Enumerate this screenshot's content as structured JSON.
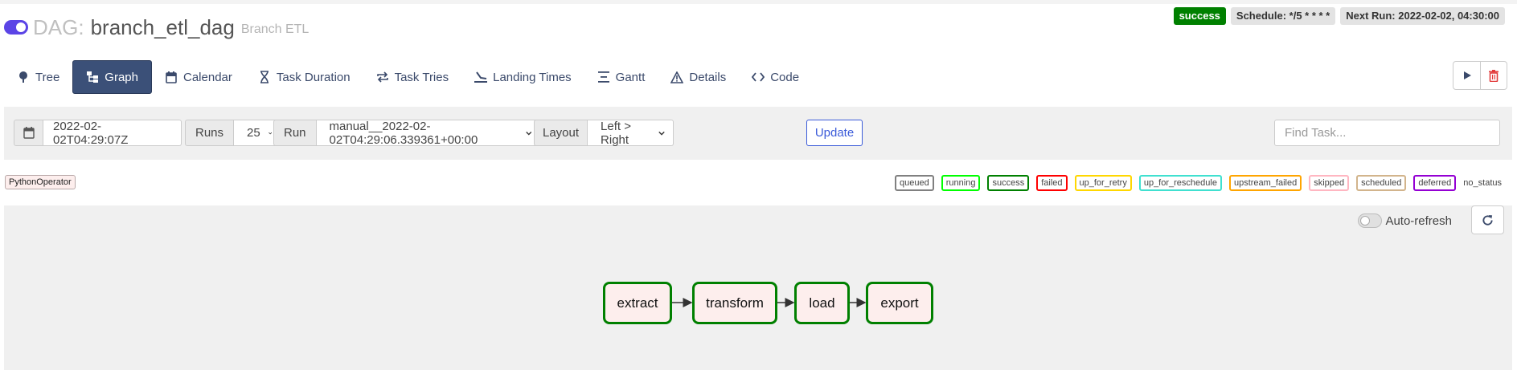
{
  "header": {
    "dag_prefix": "DAG:",
    "dag_id": "branch_etl_dag",
    "description": "Branch ETL",
    "status": "success",
    "schedule": "Schedule: */5 * * * *",
    "next_run": "Next Run: 2022-02-02, 04:30:00"
  },
  "tabs": [
    {
      "label": "Tree",
      "icon": "tree-icon"
    },
    {
      "label": "Graph",
      "icon": "graph-icon",
      "active": true
    },
    {
      "label": "Calendar",
      "icon": "calendar-icon"
    },
    {
      "label": "Task Duration",
      "icon": "hourglass-icon"
    },
    {
      "label": "Task Tries",
      "icon": "retry-icon"
    },
    {
      "label": "Landing Times",
      "icon": "landing-icon"
    },
    {
      "label": "Gantt",
      "icon": "gantt-icon"
    },
    {
      "label": "Details",
      "icon": "warning-triangle-icon"
    },
    {
      "label": "Code",
      "icon": "code-icon"
    }
  ],
  "actions": {
    "trigger": "play-icon",
    "delete": "trash-icon"
  },
  "controls": {
    "base_date": "2022-02-02T04:29:07Z",
    "runs_label": "Runs",
    "runs_value": "25",
    "run_label": "Run",
    "run_value": "manual__2022-02-02T04:29:06.339361+00:00",
    "layout_label": "Layout",
    "layout_value": "Left > Right",
    "update_label": "Update",
    "find_task_placeholder": "Find Task..."
  },
  "legend": {
    "operator": "PythonOperator",
    "operator_color": "#fdeeed",
    "states": [
      {
        "label": "queued",
        "color": "#808080"
      },
      {
        "label": "running",
        "color": "#00ff00"
      },
      {
        "label": "success",
        "color": "#008000"
      },
      {
        "label": "failed",
        "color": "#ff0000"
      },
      {
        "label": "up_for_retry",
        "color": "#ffd700"
      },
      {
        "label": "up_for_reschedule",
        "color": "#40e0d0"
      },
      {
        "label": "upstream_failed",
        "color": "#ffa500"
      },
      {
        "label": "skipped",
        "color": "#ffb6c1"
      },
      {
        "label": "scheduled",
        "color": "#d2b48c"
      },
      {
        "label": "deferred",
        "color": "#9400d3"
      },
      {
        "label": "no_status",
        "color": ""
      }
    ]
  },
  "graph": {
    "auto_refresh_label": "Auto-refresh",
    "nodes": [
      "extract",
      "transform",
      "load",
      "export"
    ],
    "node_state_color": "#008000"
  }
}
